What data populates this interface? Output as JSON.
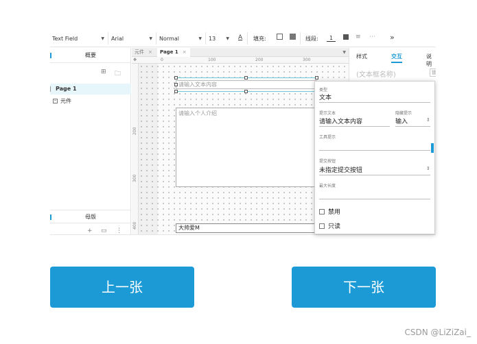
{
  "toolbar": {
    "widget_type": "Text Field",
    "font": "Arial",
    "style": "Normal",
    "size": "13",
    "fill_label": "填充:",
    "line_label": "线段:",
    "line_value": "1"
  },
  "left_panel": {
    "outline_title": "概要",
    "page_item": "Page 1",
    "element_item": "元件",
    "master_title": "母版"
  },
  "canvas": {
    "tabs": [
      {
        "label": "元件"
      },
      {
        "label": "Page 1"
      }
    ],
    "ruler_top": [
      "0",
      "100",
      "200",
      "300"
    ],
    "ruler_left": [
      "200",
      "300",
      "400"
    ],
    "textfield_placeholder": "请输入文本内容",
    "textarea_placeholder": "请输入个人介绍",
    "select_value": "大帅爱M"
  },
  "right_panel": {
    "tabs": [
      "样式",
      "交互",
      "说明"
    ],
    "active_tab": "交互",
    "name_placeholder": "(文本框名称)",
    "name_button": "锁"
  },
  "popup": {
    "type_label": "类型",
    "type_value": "文本",
    "hint_label": "提示文本",
    "hint_value": "请输入文本内容",
    "hide_label": "隐藏提示",
    "hide_value": "输入",
    "tooltip_label": "工具提示",
    "submit_label": "提交按钮",
    "submit_value": "未指定提交按钮",
    "maxlen_label": "最大长度",
    "disabled_label": "禁用",
    "readonly_label": "只读"
  },
  "buttons": {
    "prev": "上一张",
    "next": "下一张"
  },
  "watermark": "CSDN @LiZiZai_",
  "colors": {
    "accent": "#1b9ad6",
    "selection": "#6fc9da",
    "page_row_bg": "#e6f6fa"
  }
}
